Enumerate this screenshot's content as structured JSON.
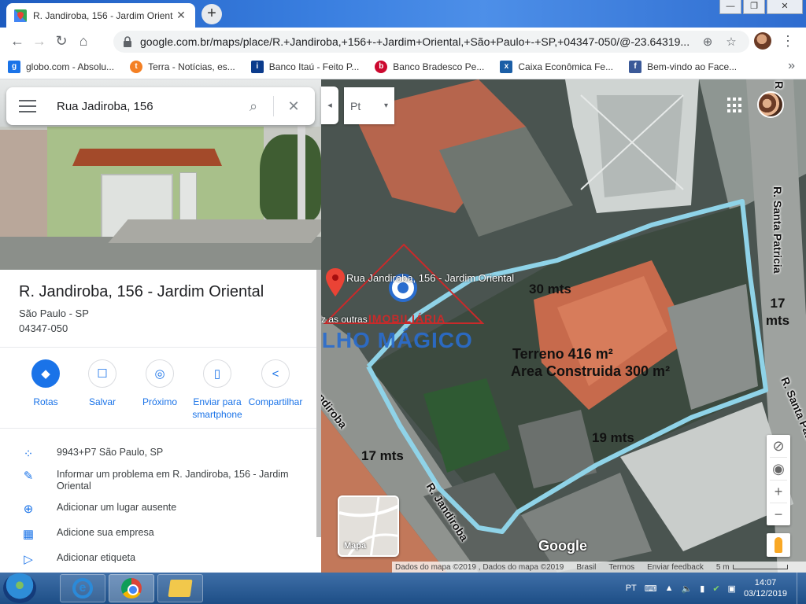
{
  "browser": {
    "tab_title": "R. Jandiroba, 156 - Jardim Orient",
    "url": "google.com.br/maps/place/R.+Jandiroba,+156+-+Jardim+Oriental,+São+Paulo+-+SP,+04347-050/@-23.64319...",
    "tab_close": "✕",
    "new_tab": "+",
    "window_buttons": [
      "—",
      "❐",
      "✕"
    ]
  },
  "bookmarks": [
    {
      "label": "globo.com - Absolu...",
      "icon": "g",
      "color": "#1a73e8"
    },
    {
      "label": "Terra - Notícias, es...",
      "icon": "t",
      "color": "#f48024"
    },
    {
      "label": "Banco Itaú - Feito P...",
      "icon": "i",
      "color": "#0b3b8c"
    },
    {
      "label": "Banco Bradesco  Pe...",
      "icon": "b",
      "color": "#cc092f"
    },
    {
      "label": "Caixa Econômica Fe...",
      "icon": "x",
      "color": "#1b5ea6"
    },
    {
      "label": "Bem-vindo ao Face...",
      "icon": "f",
      "color": "#3b5998"
    }
  ],
  "search": {
    "value": "Rua Jadiroba, 156"
  },
  "place": {
    "title": "R. Jandiroba, 156 - Jardim Oriental",
    "city": "São Paulo - SP",
    "cep": "04347-050"
  },
  "actions": [
    {
      "label": "Rotas",
      "icon": "◆"
    },
    {
      "label": "Salvar",
      "icon": "☐"
    },
    {
      "label": "Próximo",
      "icon": "◎"
    },
    {
      "label": "Enviar para smartphone",
      "icon": "▯"
    },
    {
      "label": "Compartilhar",
      "icon": "<"
    }
  ],
  "info": [
    {
      "text": "9943+P7 São Paulo, SP",
      "icon": "⁘"
    },
    {
      "text": "Informar um problema em R. Jandiroba, 156 - Jardim Oriental",
      "icon": "✎"
    },
    {
      "text": "Adicionar um lugar ausente",
      "icon": "⊕"
    },
    {
      "text": "Adicione sua empresa",
      "icon": "▦"
    },
    {
      "text": "Adicionar etiqueta",
      "icon": "▷"
    }
  ],
  "map": {
    "layer_label": "Pt",
    "pin_label": "Rua Jandiroba, 156 - Jardim Oriental",
    "other_text": "z as outras",
    "watermark_top": "IMOBILIÁRIA",
    "watermark_main": "OLHO MÁGICO",
    "dim_top": "30 mts",
    "dim_right": "17 mts",
    "dim_bottom": "19 mts",
    "dim_left": "17 mts",
    "terreno": "Terreno 416 m²",
    "area": "Area Construida 300 m²",
    "street_jandiroba_1": "R. Jandiroba",
    "street_jandiroba_2": "R. Jandiroba",
    "street_santa_1": "R. Santa Patricia",
    "street_santa_2": "R. Santa Patricia",
    "street_r_top": "R",
    "google": "Google",
    "minimap_label": "Mapa",
    "zoom_in": "+",
    "zoom_out": "−",
    "boundary_color": "#8fd3e8"
  },
  "attribution": {
    "data": "Dados do mapa ©2019 , Dados do mapa ©2019",
    "country": "Brasil",
    "terms": "Termos",
    "feedback": "Enviar feedback",
    "scale": "5 m"
  },
  "taskbar": {
    "lang": "PT",
    "time": "14:07",
    "date": "03/12/2019"
  }
}
